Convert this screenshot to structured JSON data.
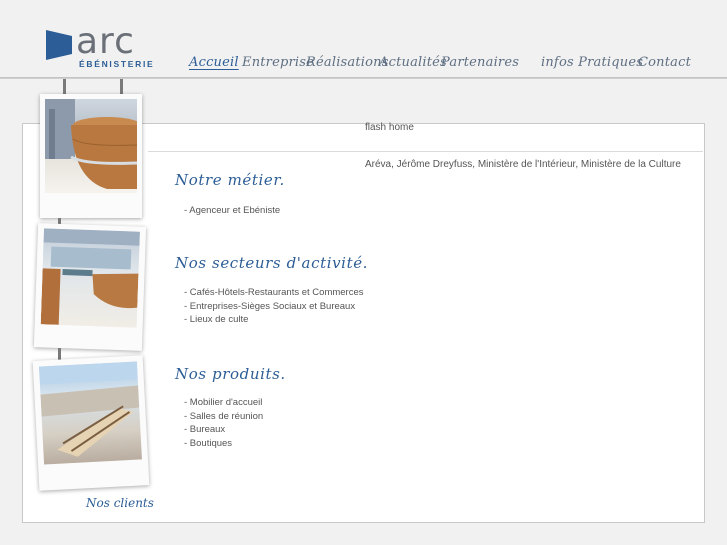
{
  "brand": {
    "name": "arc",
    "subtitle": "ÉBÉNISTERIE",
    "color": "#2c5d96"
  },
  "nav": {
    "items": [
      {
        "label": "Accueil",
        "active": true
      },
      {
        "label": "Entreprise"
      },
      {
        "label": "Réalisations"
      },
      {
        "label": "Actualités"
      },
      {
        "label": "Partenaires"
      },
      {
        "label": "infos Pratiques"
      },
      {
        "label": "Contact"
      }
    ]
  },
  "main": {
    "flash_text": "flash home",
    "clients_text": "Aréva, Jérôme Dreyfuss, Ministère de l'Intérieur, Ministère de la Culture",
    "sections": [
      {
        "title": "Notre métier.",
        "items": [
          "- Agenceur et Ebéniste"
        ]
      },
      {
        "title": "Nos secteurs d'activité.",
        "items": [
          "- Cafés-Hôtels-Restaurants et Commerces",
          "- Entreprises-Sièges Sociaux et Bureaux",
          "- Lieux de culte"
        ]
      },
      {
        "title": "Nos produits.",
        "items": [
          "- Mobilier d'accueil",
          "- Salles de réunion",
          "- Bureaux",
          "- Boutiques"
        ]
      }
    ]
  },
  "sidebar": {
    "clients_label": "Nos clients"
  }
}
